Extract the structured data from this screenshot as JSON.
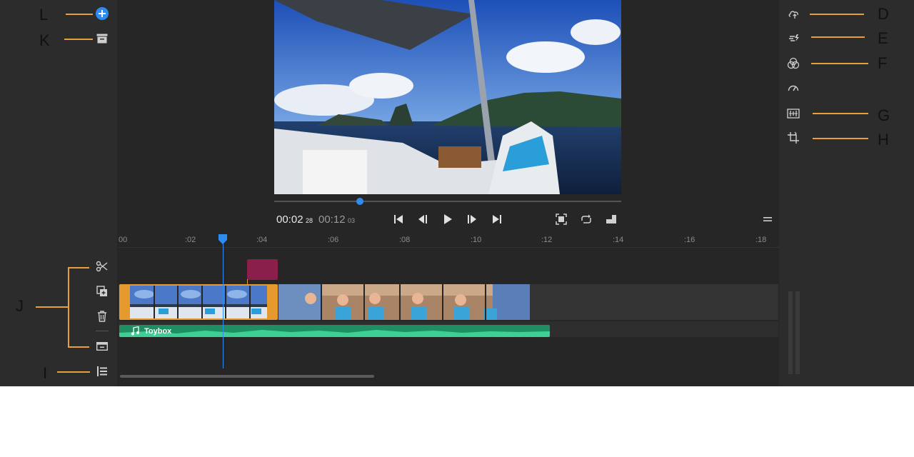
{
  "callouts": {
    "L": "L",
    "K": "K",
    "J": "J",
    "I": "I",
    "D": "D",
    "E": "E",
    "F": "F",
    "G": "G",
    "H": "H"
  },
  "player": {
    "current_time": "00:02",
    "current_frames": "28",
    "total_time": "00:12",
    "total_frames": "03",
    "progress_fraction": 0.24
  },
  "ruler": {
    "ticks": [
      "00",
      ":02",
      ":04",
      ":06",
      ":08",
      ":10",
      ":12",
      ":14",
      ":16",
      ":18"
    ]
  },
  "audio": {
    "clip_name": "Toybox"
  },
  "left_tools": [
    "add-media-icon",
    "archive-icon",
    "split-icon",
    "duplicate-icon",
    "trash-icon",
    "detach-audio-icon",
    "track-list-icon"
  ],
  "right_tools": [
    "adjust-icon",
    "transition-icon",
    "color-icon",
    "speed-icon",
    "audio-adjust-icon",
    "crop-icon"
  ],
  "colors": {
    "accent_blue": "#2d8cf0",
    "clip_selected": "#e69a2d",
    "audio_green": "#1f8f63",
    "marker": "#8a1f4c",
    "callout_line": "#e8a13a"
  }
}
